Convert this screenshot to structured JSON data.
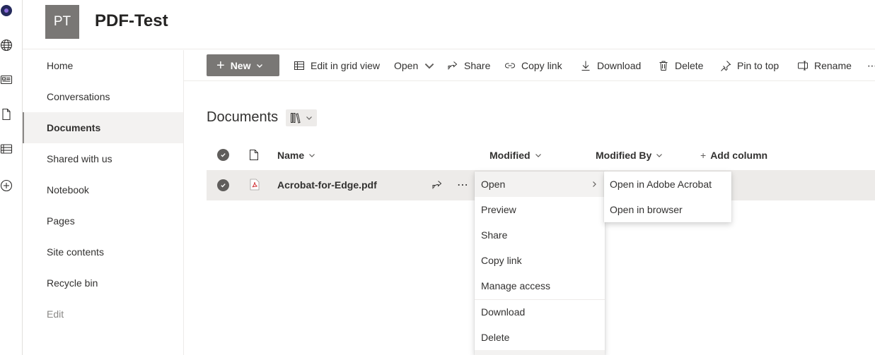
{
  "site": {
    "logo_initials": "PT",
    "title": "PDF-Test"
  },
  "rail": {
    "icons": [
      "app-logo-icon",
      "globe-icon",
      "news-icon",
      "file-icon",
      "list-icon",
      "add-circle-icon"
    ]
  },
  "nav": {
    "items": [
      "Home",
      "Conversations",
      "Documents",
      "Shared with us",
      "Notebook",
      "Pages",
      "Site contents",
      "Recycle bin"
    ],
    "edit": "Edit",
    "active_index": 2
  },
  "commandbar": {
    "new_label": "New",
    "edit_grid": "Edit in grid view",
    "open": "Open",
    "share": "Share",
    "copy_link": "Copy link",
    "download": "Download",
    "delete": "Delete",
    "pin_to_top": "Pin to top",
    "rename": "Rename",
    "more": "⋯"
  },
  "library": {
    "title": "Documents",
    "columns": {
      "name": "Name",
      "modified": "Modified",
      "modified_by": "Modified By",
      "add_column": "Add column"
    },
    "rows": [
      {
        "name": "Acrobat-for-Edge.pdf",
        "selected": true
      }
    ]
  },
  "context_menu": {
    "items": [
      "Open",
      "Preview",
      "Share",
      "Copy link",
      "Manage access",
      "Download",
      "Delete"
    ],
    "highlighted": "Open"
  },
  "open_submenu": {
    "items": [
      "Open in Adobe Acrobat",
      "Open in browser"
    ]
  },
  "colors": {
    "accent_gray": "#797775",
    "selected_row": "#edebe9",
    "pdf_red": "#d13438"
  }
}
